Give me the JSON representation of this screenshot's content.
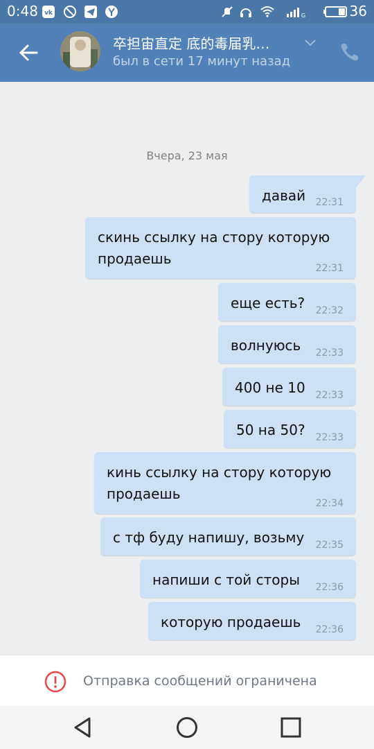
{
  "status_bar": {
    "time": "0:48",
    "battery": "36",
    "network": "G"
  },
  "header": {
    "title": "卒担宙直定 底的毒届乳…",
    "subtitle": "был в сети 17 минут назад"
  },
  "date_separator": "Вчера, 23 мая",
  "messages": [
    {
      "text": "давай",
      "time": "22:31"
    },
    {
      "text": "скинь ссылку на стору которую\nпродаешь",
      "time": "22:31"
    },
    {
      "text": "еще есть?",
      "time": "22:32"
    },
    {
      "text": "волнуюсь",
      "time": "22:33"
    },
    {
      "text": "400 не 10",
      "time": "22:33"
    },
    {
      "text": "50 на 50?",
      "time": "22:33"
    },
    {
      "text": "кинь ссылку на стору которую\nпродаешь",
      "time": "22:34"
    },
    {
      "text": "с тф буду напишу, возьму",
      "time": "22:35"
    },
    {
      "text": "напиши с той сторы",
      "time": "22:36"
    },
    {
      "text": "которую продаешь",
      "time": "22:36"
    }
  ],
  "footer": {
    "restriction_text": "Отправка сообщений ограничена"
  },
  "colors": {
    "header": "#5181b8",
    "status_bar": "#4a76a8",
    "bubble": "#cee0f5",
    "background": "#edeef0",
    "alert": "#e64646"
  }
}
